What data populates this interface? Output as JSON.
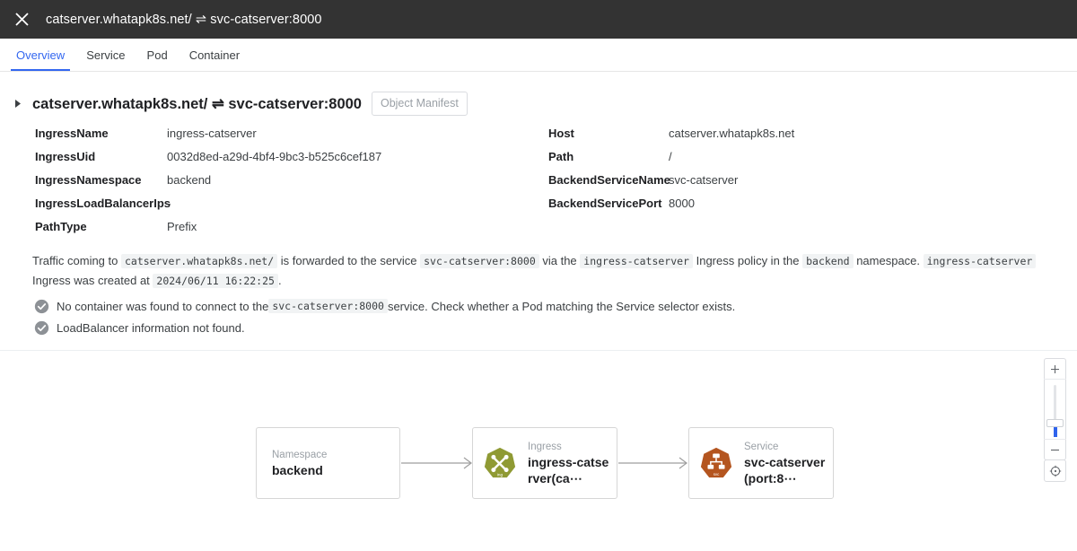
{
  "titlebar": {
    "close_icon": "close-icon",
    "title": "catserver.whatapk8s.net/ ⇌ svc-catserver:8000"
  },
  "tabs": [
    {
      "label": "Overview",
      "active": true
    },
    {
      "label": "Service",
      "active": false
    },
    {
      "label": "Pod",
      "active": false
    },
    {
      "label": "Container",
      "active": false
    }
  ],
  "detail": {
    "section_title": "catserver.whatapk8s.net/ ⇌ svc-catserver:8000",
    "manifest_button": "Object Manifest",
    "fields_left": [
      {
        "key": "IngressName",
        "value": "ingress-catserver"
      },
      {
        "key": "IngressUid",
        "value": "0032d8ed-a29d-4bf4-9bc3-b525c6cef187"
      },
      {
        "key": "IngressNamespace",
        "value": "backend"
      },
      {
        "key": "IngressLoadBalancerIps",
        "value": "-"
      },
      {
        "key": "PathType",
        "value": "Prefix"
      }
    ],
    "fields_right": [
      {
        "key": "Host",
        "value": "catserver.whatapk8s.net"
      },
      {
        "key": "Path",
        "value": "/"
      },
      {
        "key": "BackendServiceName",
        "value": "svc-catserver"
      },
      {
        "key": "BackendServicePort",
        "value": "8000"
      }
    ],
    "traffic": {
      "t1": "Traffic coming to ",
      "c1": "catserver.whatapk8s.net/",
      "t2": " is forwarded to the service ",
      "c2": "svc-catserver:8000",
      "t3": " via the ",
      "c3": "ingress-catserver",
      "t4": " Ingress policy in the ",
      "c4": "backend",
      "t5": " namespace. ",
      "c5": "ingress-catserver",
      "t6": " Ingress was created at ",
      "c6": "2024/06/11 16:22:25",
      "t7": "."
    },
    "status": [
      {
        "icon": "check-circle-icon",
        "t1": "No container was found to connect to the ",
        "code": "svc-catserver:8000",
        "t2": " service. Check whether a Pod matching the Service selector exists."
      },
      {
        "icon": "check-circle-icon",
        "t1": "LoadBalancer information not found.",
        "code": "",
        "t2": ""
      }
    ]
  },
  "graph": {
    "nodes": [
      {
        "kind": "Namespace",
        "name": "backend",
        "icon": "none"
      },
      {
        "kind": "Ingress",
        "name": "ingress-catserver(ca⋯",
        "icon": "ingress-icon"
      },
      {
        "kind": "Service",
        "name": "svc-catserver(port:8⋯",
        "icon": "service-icon"
      }
    ],
    "colors": {
      "ingress_icon": "#8f9a34",
      "service_icon": "#b4551f",
      "edge": "#9e9e9e"
    }
  },
  "controls": {
    "zoom_in": "+",
    "zoom_out": "−",
    "recenter_icon": "crosshair-icon",
    "slider_icon": "zoom-slider"
  },
  "theme": {
    "accent": "#3367f0",
    "titlebar_bg": "#333333",
    "page_bg": "#ffffff"
  }
}
